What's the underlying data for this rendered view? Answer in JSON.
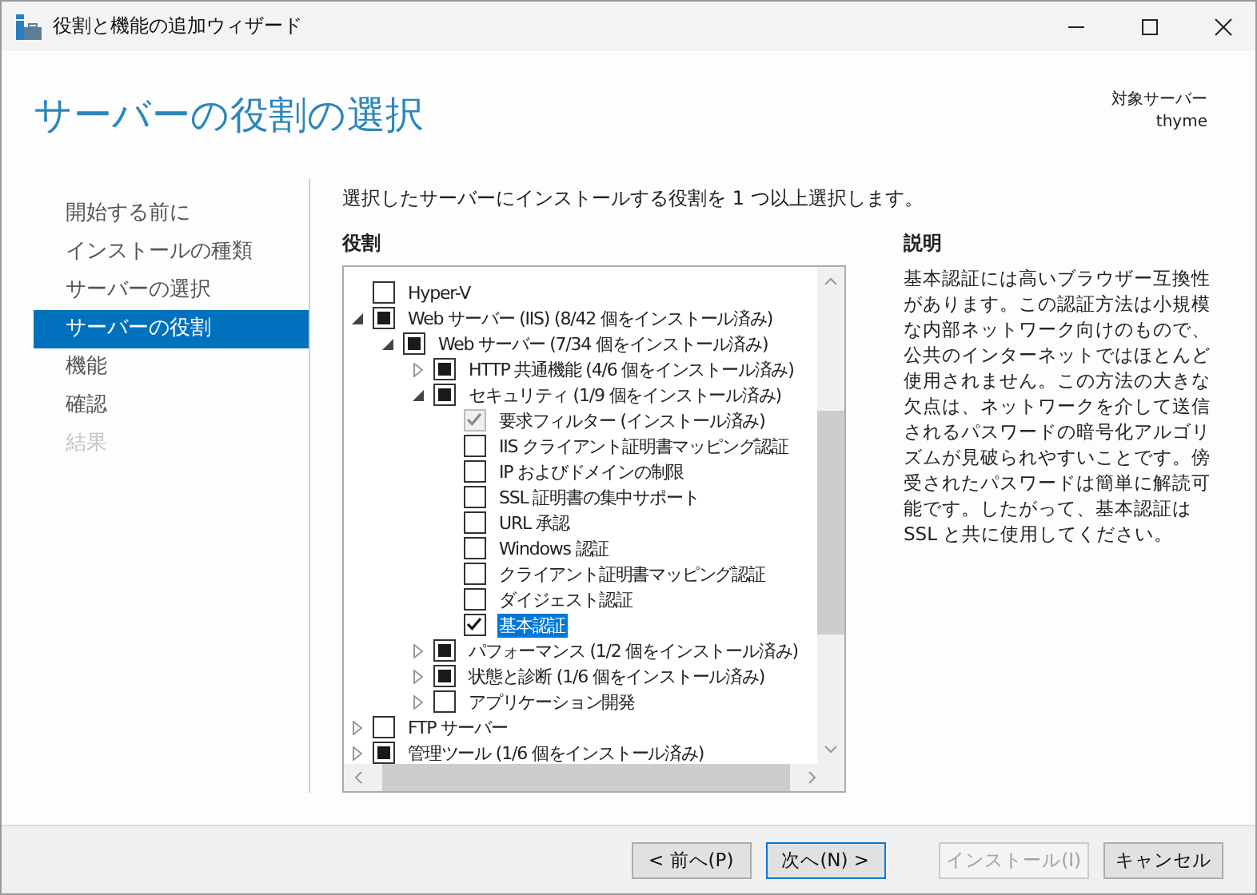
{
  "window": {
    "title": "役割と機能の追加ウィザード"
  },
  "header": {
    "title": "サーバーの役割の選択",
    "target_label": "対象サーバー",
    "target_value": "thyme"
  },
  "sidebar": {
    "items": [
      {
        "label": "開始する前に",
        "selected": false,
        "disabled": false
      },
      {
        "label": "インストールの種類",
        "selected": false,
        "disabled": false
      },
      {
        "label": "サーバーの選択",
        "selected": false,
        "disabled": false
      },
      {
        "label": "サーバーの役割",
        "selected": true,
        "disabled": false
      },
      {
        "label": "機能",
        "selected": false,
        "disabled": false
      },
      {
        "label": "確認",
        "selected": false,
        "disabled": false
      },
      {
        "label": "結果",
        "selected": false,
        "disabled": true
      }
    ]
  },
  "instruction": "選択したサーバーにインストールする役割を 1 つ以上選択します。",
  "roles": {
    "heading": "役割",
    "tree": [
      {
        "label": "Hyper-V",
        "checked": false,
        "partial": false,
        "disabled": false,
        "selected": false
      },
      {
        "label": "Web サーバー (IIS) (8/42 個をインストール済み)",
        "checked": false,
        "partial": true,
        "disabled": false,
        "selected": false,
        "expanded": true,
        "children": [
          {
            "label": "Web サーバー (7/34 個をインストール済み)",
            "checked": false,
            "partial": true,
            "disabled": false,
            "selected": false,
            "expanded": true,
            "children": [
              {
                "label": "HTTP 共通機能 (4/6 個をインストール済み)",
                "checked": false,
                "partial": true,
                "disabled": false,
                "selected": false,
                "expanded": false
              },
              {
                "label": "セキュリティ (1/9 個をインストール済み)",
                "checked": false,
                "partial": true,
                "disabled": false,
                "selected": false,
                "expanded": true,
                "children": [
                  {
                    "label": "要求フィルター (インストール済み)",
                    "checked": true,
                    "partial": false,
                    "disabled": true,
                    "selected": false
                  },
                  {
                    "label": "IIS クライアント証明書マッピング認証",
                    "checked": false,
                    "partial": false,
                    "disabled": false,
                    "selected": false
                  },
                  {
                    "label": "IP およびドメインの制限",
                    "checked": false,
                    "partial": false,
                    "disabled": false,
                    "selected": false
                  },
                  {
                    "label": "SSL 証明書の集中サポート",
                    "checked": false,
                    "partial": false,
                    "disabled": false,
                    "selected": false
                  },
                  {
                    "label": "URL 承認",
                    "checked": false,
                    "partial": false,
                    "disabled": false,
                    "selected": false
                  },
                  {
                    "label": "Windows 認証",
                    "checked": false,
                    "partial": false,
                    "disabled": false,
                    "selected": false
                  },
                  {
                    "label": "クライアント証明書マッピング認証",
                    "checked": false,
                    "partial": false,
                    "disabled": false,
                    "selected": false
                  },
                  {
                    "label": "ダイジェスト認証",
                    "checked": false,
                    "partial": false,
                    "disabled": false,
                    "selected": false
                  },
                  {
                    "label": "基本認証",
                    "checked": true,
                    "partial": false,
                    "disabled": false,
                    "selected": true
                  }
                ]
              },
              {
                "label": "パフォーマンス (1/2 個をインストール済み)",
                "checked": false,
                "partial": true,
                "disabled": false,
                "selected": false,
                "expanded": false
              },
              {
                "label": "状態と診断 (1/6 個をインストール済み)",
                "checked": false,
                "partial": true,
                "disabled": false,
                "selected": false,
                "expanded": false
              },
              {
                "label": "アプリケーション開発",
                "checked": false,
                "partial": false,
                "disabled": false,
                "selected": false,
                "expanded": false
              }
            ]
          }
        ]
      },
      {
        "label": "FTP サーバー",
        "checked": false,
        "partial": false,
        "disabled": false,
        "selected": false,
        "expanded": false
      },
      {
        "label": "管理ツール (1/6 個をインストール済み)",
        "checked": false,
        "partial": true,
        "disabled": false,
        "selected": false,
        "expanded": false
      }
    ]
  },
  "description": {
    "heading": "説明",
    "text": "基本認証には高いブラウザー互換性があります。この認証方法は小規模な内部ネットワーク向けのもので、公共のインターネットではほとんど使用されません。この方法の大きな欠点は、ネットワークを介して送信されるパスワードの暗号化アルゴリズムが見破られやすいことです。傍受されたパスワードは簡単に解読可能です。したがって、基本認証は SSL と共に使用してください。"
  },
  "buttons": [
    {
      "label": "< 前へ(P)",
      "disabled": false,
      "focused": false
    },
    {
      "label": "次へ(N) >",
      "disabled": false,
      "focused": true
    },
    {
      "label": "インストール(I)",
      "disabled": true,
      "focused": false
    },
    {
      "label": "キャンセル",
      "disabled": false,
      "focused": false
    }
  ]
}
